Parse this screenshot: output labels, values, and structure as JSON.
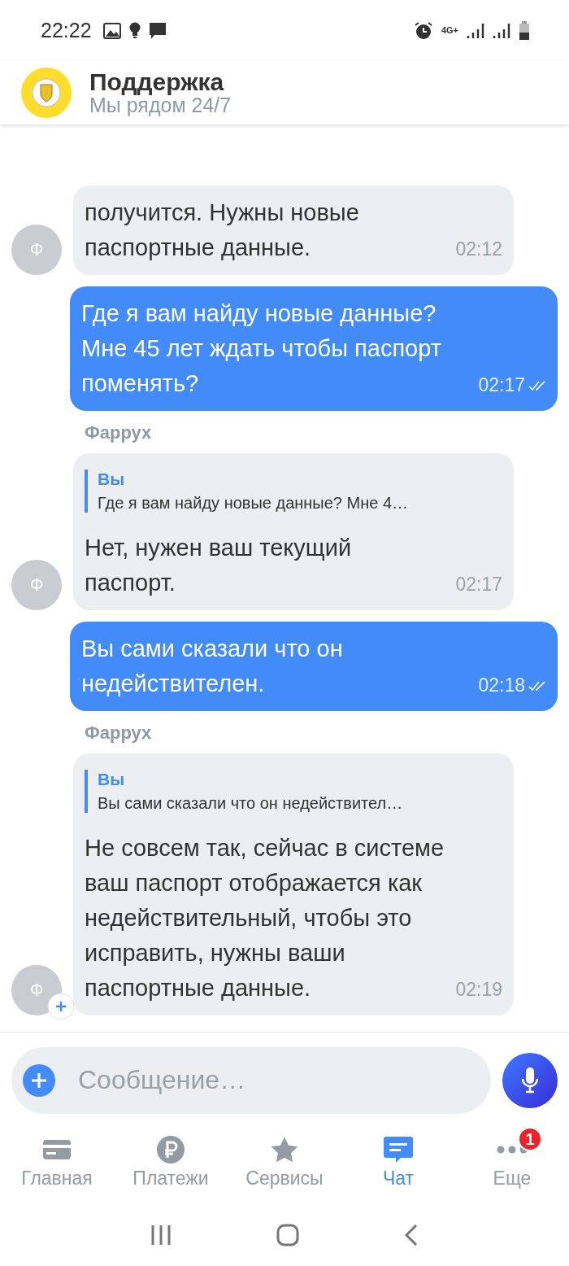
{
  "status_bar": {
    "time": "22:22",
    "network": "4G+"
  },
  "header": {
    "title": "Поддержка",
    "subtitle": "Мы рядом 24/7"
  },
  "messages": [
    {
      "kind": "incoming",
      "avatar": "Ф",
      "text": "получится. Нужны новые паспортные данные.",
      "time": "02:12"
    },
    {
      "kind": "outgoing",
      "text": "Где я вам найду новые данные? Мне 45 лет ждать чтобы паспорт поменять?",
      "time": "02:17",
      "read": true
    },
    {
      "kind": "incoming",
      "sender": "Фаррух",
      "avatar": "Ф",
      "quote": {
        "author": "Вы",
        "text": "Где я вам найду новые данные? Мне 4…"
      },
      "text": "Нет, нужен ваш текущий паспорт.",
      "time": "02:17"
    },
    {
      "kind": "outgoing",
      "text": "Вы сами сказали что он недействителен.",
      "time": "02:18",
      "read": true
    },
    {
      "kind": "incoming",
      "sender": "Фаррух",
      "avatar": "Ф",
      "avatar_badge": true,
      "quote": {
        "author": "Вы",
        "text": "Вы сами сказали что он недействител…"
      },
      "text": "Не совсем так, сейчас в системе ваш паспорт отображается как недействительный, чтобы это исправить, нужны ваши паспортные данные.",
      "time": "02:19"
    }
  ],
  "composer": {
    "placeholder": "Сообщение…"
  },
  "tabs": [
    {
      "kind": "card",
      "label": "Главная",
      "selected": false
    },
    {
      "kind": "ruble",
      "label": "Платежи",
      "selected": false
    },
    {
      "kind": "star",
      "label": "Сервисы",
      "selected": false
    },
    {
      "kind": "chat",
      "label": "Чат",
      "selected": true
    },
    {
      "kind": "more",
      "label": "Еще",
      "selected": false,
      "badge": "1"
    }
  ]
}
